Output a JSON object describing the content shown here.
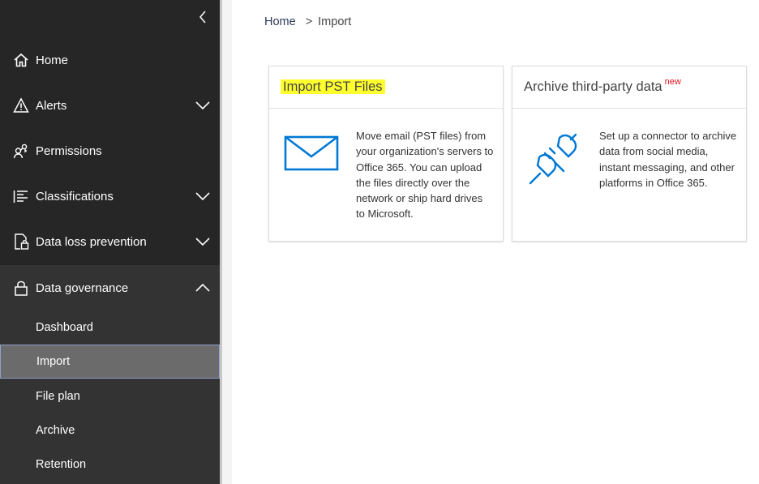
{
  "sidebar": {
    "items": [
      {
        "label": "Home",
        "icon": "home-icon"
      },
      {
        "label": "Alerts",
        "icon": "alert-triangle-icon"
      },
      {
        "label": "Permissions",
        "icon": "people-key-icon"
      },
      {
        "label": "Classifications",
        "icon": "list-icon"
      },
      {
        "label": "Data loss prevention",
        "icon": "document-lock-icon"
      },
      {
        "label": "Data governance",
        "icon": "lock-icon"
      }
    ],
    "sub_items": [
      {
        "label": "Dashboard"
      },
      {
        "label": "Import"
      },
      {
        "label": "File plan"
      },
      {
        "label": "Archive"
      },
      {
        "label": "Retention"
      }
    ],
    "active_sub_item": "Import",
    "expanded_item": "Data governance"
  },
  "breadcrumb": {
    "home": "Home",
    "separator": ">",
    "current": "Import"
  },
  "cards": [
    {
      "title": "Import PST Files",
      "description": "Move email (PST files) from your organization's servers to Office 365. You can upload the files directly over the network or ship hard drives to Microsoft.",
      "icon": "envelope-icon"
    },
    {
      "title": "Archive third-party data",
      "badge": "new",
      "description": "Set up a connector to archive data from social media, instant messaging, and other platforms in Office 365.",
      "icon": "plug-connector-icon"
    }
  ],
  "colors": {
    "sidebar_bg": "#262626",
    "sidebar_sub_bg": "#333333",
    "active_item_bg": "#6b6b6b",
    "accent_blue": "#0078d4",
    "highlight_yellow": "#ffff2e",
    "badge_red": "#e81123"
  }
}
